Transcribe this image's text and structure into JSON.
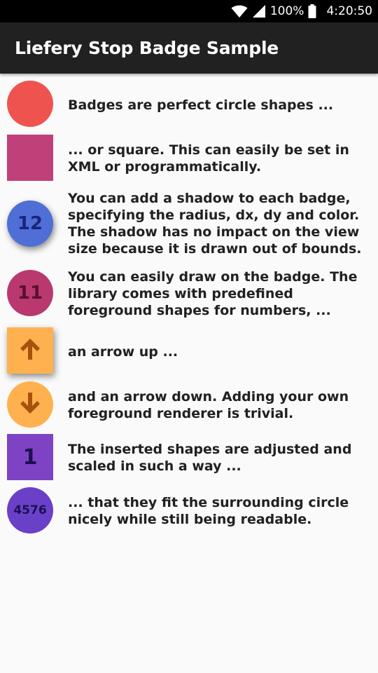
{
  "status_bar": {
    "battery_percent": "100%",
    "time": "4:20:50",
    "icons": [
      "wifi-icon",
      "signal-icon",
      "battery-icon"
    ]
  },
  "app_bar": {
    "title": "Liefery Stop Badge Sample"
  },
  "items": [
    {
      "text": "Badges are perfect circle shapes ...",
      "badge_shape": "circle",
      "badge_color": "#ef5350",
      "badge_label": ""
    },
    {
      "text": "... or square. This can easily be set in XML or programmatically.",
      "badge_shape": "square",
      "badge_color": "#c0407a",
      "badge_label": ""
    },
    {
      "text": "You can add a shadow to each badge, specifying the radius, dx, dy and color. The shadow has no impact on the view size because it is drawn out of bounds.",
      "badge_shape": "circle",
      "badge_color": "#4f6fd6",
      "badge_label": "12",
      "badge_label_color": "#1a237e"
    },
    {
      "text": "You can easily draw on the badge. The library comes with predefined foreground shapes for numbers, ...",
      "badge_shape": "circle",
      "badge_color": "#b9396e",
      "badge_label": "11",
      "badge_label_color": "#5a1030"
    },
    {
      "text": "an arrow up ...",
      "badge_shape": "square",
      "badge_color": "#ffb14f",
      "badge_icon": "arrow-up-icon",
      "badge_icon_color": "#a8510a"
    },
    {
      "text": "and an arrow down. Adding your own foreground renderer is trivial.",
      "badge_shape": "circle",
      "badge_color": "#ffb14f",
      "badge_icon": "arrow-down-icon",
      "badge_icon_color": "#a8510a"
    },
    {
      "text": "The inserted shapes are adjusted and scaled in such a way ...",
      "badge_shape": "square",
      "badge_color": "#7e43c4",
      "badge_label": "1",
      "badge_label_color": "#1c0f52"
    },
    {
      "text": "... that they fit the surrounding circle nicely while still being readable.",
      "badge_shape": "circle",
      "badge_color": "#6a40c8",
      "badge_label": "4576",
      "badge_label_color": "#1c0f52"
    }
  ]
}
